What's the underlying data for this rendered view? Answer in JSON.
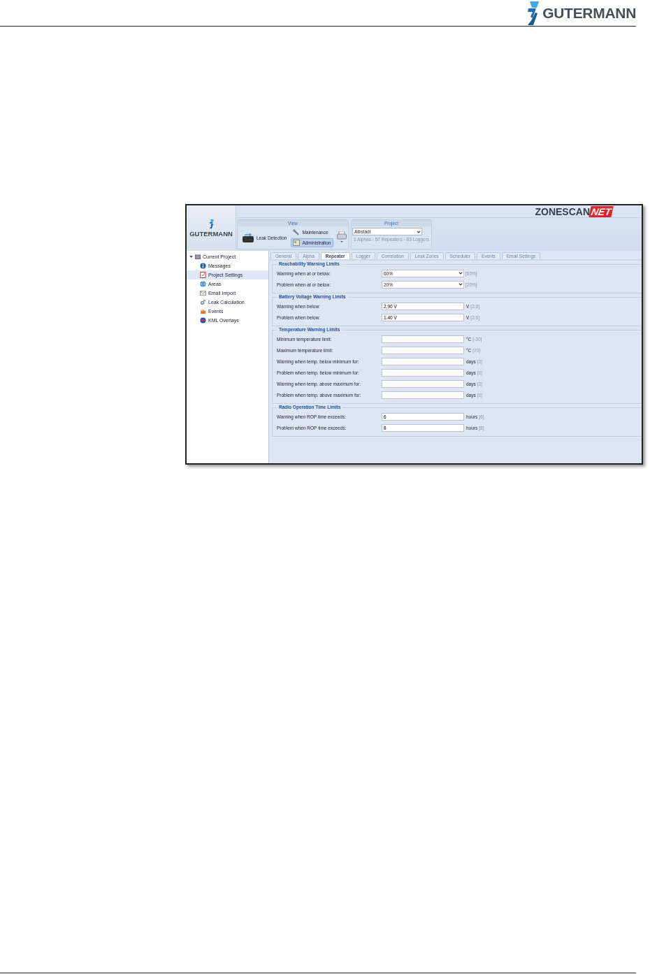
{
  "page_header": {
    "brand": "GUTERMANN"
  },
  "app": {
    "logo": "GUTERMANN",
    "brand_left": "ZONESCAN",
    "brand_right": "NET",
    "view": {
      "title": "View",
      "buttons": [
        {
          "label": "Leak Detection",
          "selected": false
        },
        {
          "label": "Maintenance",
          "selected": false
        },
        {
          "label": "Administration",
          "selected": true
        }
      ]
    },
    "project": {
      "title": "Project",
      "value": "Albstadt",
      "summary": "1 Alphas - 57 Repeaters - 83 Loggers"
    },
    "tree": {
      "label": "Current Project",
      "expanded": true,
      "children": [
        {
          "label": "Messages",
          "selected": false
        },
        {
          "label": "Project Settings",
          "selected": true
        },
        {
          "label": "Areas",
          "selected": false
        },
        {
          "label": "Email Import",
          "selected": false
        },
        {
          "label": "Leak Calculation",
          "selected": false
        },
        {
          "label": "Events",
          "selected": false
        },
        {
          "label": "KML Overlays",
          "selected": false
        }
      ]
    },
    "tabs": [
      {
        "label": "General",
        "selected": false
      },
      {
        "label": "Alpha",
        "selected": false
      },
      {
        "label": "Repeater",
        "selected": true
      },
      {
        "label": "Logger",
        "selected": false
      },
      {
        "label": "Correlation",
        "selected": false
      },
      {
        "label": "Leak Zones",
        "selected": false
      },
      {
        "label": "Scheduler",
        "selected": false
      },
      {
        "label": "Events",
        "selected": false
      },
      {
        "label": "Email Settings",
        "selected": false
      }
    ],
    "sections": [
      {
        "title": "Reachability Warning Limits",
        "rows": [
          {
            "kind": "select",
            "label": "Warning when at or below:",
            "value": "60%",
            "default": "[60%]"
          },
          {
            "kind": "select",
            "label": "Problem when at or below:",
            "value": "20%",
            "default": "[20%]"
          }
        ]
      },
      {
        "title": "Battery Voltage Warning Limits",
        "rows": [
          {
            "kind": "text",
            "label": "Warning when below:",
            "value": "2.90 V",
            "unit": "V",
            "default": "[2.8]"
          },
          {
            "kind": "text",
            "label": "Problem when below:",
            "value": "1.40 V",
            "unit": "V",
            "default": "[2.6]"
          }
        ]
      },
      {
        "title": "Temperature Warning Limits",
        "rows": [
          {
            "kind": "text",
            "label": "Minimum temperature limit:",
            "unit": "°C",
            "default": "[-30]"
          },
          {
            "kind": "text",
            "label": "Maximum temperature limit:",
            "unit": "°C",
            "default": "[70]"
          },
          {
            "kind": "text",
            "label": "Warning when temp. below minimum for:",
            "unit": "days",
            "default": "[3]"
          },
          {
            "kind": "text",
            "label": "Problem when temp. below minimum for:",
            "unit": "days",
            "default": "[6]"
          },
          {
            "kind": "text",
            "label": "Warning when temp. above maximum for:",
            "unit": "days",
            "default": "[3]"
          },
          {
            "kind": "text",
            "label": "Problem when temp. above maximum for:",
            "unit": "days",
            "default": "[6]"
          }
        ]
      },
      {
        "title": "Radio Operation Time Limits",
        "rows": [
          {
            "kind": "text",
            "label": "Warning when ROP time exceeds:",
            "value": "6",
            "unit": "hours",
            "default": "[6]"
          },
          {
            "kind": "text",
            "label": "Problem when ROP time exceeds:",
            "value": "8",
            "unit": "hours",
            "default": "[8]"
          }
        ]
      }
    ]
  }
}
